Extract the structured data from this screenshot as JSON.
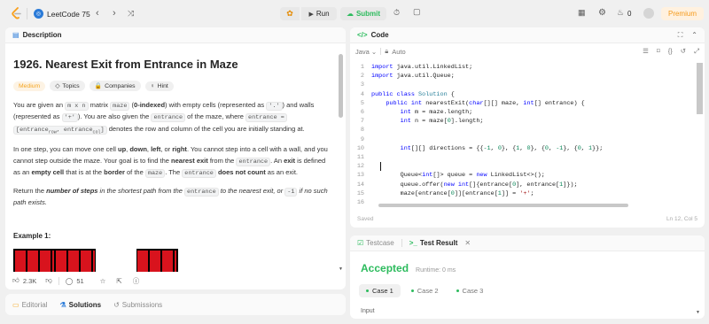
{
  "topbar": {
    "list_title": "LeetCode 75",
    "run": "Run",
    "submit": "Submit",
    "streak": "0",
    "premium": "Premium"
  },
  "left": {
    "tab": "Description",
    "title": "1926. Nearest Exit from Entrance in Maze",
    "difficulty": "Medium",
    "chip_topics": "Topics",
    "chip_companies": "Companies",
    "chip_hint": "Hint",
    "p1": {
      "a": "You are given an ",
      "b": "m x n",
      "c": " matrix ",
      "d": "maze",
      "e": " (",
      "f": "0-indexed",
      "g": ") with empty cells (represented as ",
      "h": "'.'",
      "i": ") and walls (represented as ",
      "j": "'+'",
      "k": "). You are also given the ",
      "l": "entrance",
      "m": " of the maze, where ",
      "n": "entrance =",
      "o": "[entrance",
      "o_sub": "row",
      "p": ", entrance",
      "p_sub": "col",
      "q": "]",
      "r": " denotes the row and column of the cell you are initially standing at."
    },
    "p2": {
      "a": "In one step, you can move one cell ",
      "b": "up",
      "c": ", ",
      "d": "down",
      "e": ", ",
      "f": "left",
      "g": ", or ",
      "h": "right",
      "i": ". You cannot step into a cell with a wall, and you cannot step outside the maze. Your goal is to find the ",
      "j": "nearest exit",
      "k": " from the ",
      "l": "entrance",
      "m": ". An ",
      "n": "exit",
      "o": " is defined as an ",
      "p": "empty cell",
      "q": " that is at the ",
      "r": "border",
      "s": " of the ",
      "t": "maze",
      "u": ". The ",
      "v": "entrance",
      "w": " ",
      "x": "does not count",
      "y": " as an exit."
    },
    "p3": {
      "a": "Return the ",
      "b": "number of steps",
      "c": " in the shortest path from the ",
      "d": "entrance",
      "e": " to the nearest exit, or ",
      "f": "-1",
      "g": " if no such path exists."
    },
    "example": "Example 1:",
    "likes": "2.3K",
    "comments": "51",
    "bottom_tabs": {
      "editorial": "Editorial",
      "solutions": "Solutions",
      "submissions": "Submissions"
    }
  },
  "code": {
    "tab": "Code",
    "language": "Java",
    "auto": "Auto",
    "saved": "Saved",
    "cursor": "Ln 12, Col 5",
    "lines": [
      {
        "n": "1",
        "t": [
          [
            "kw",
            "import"
          ],
          [
            "pl",
            " java.util.LinkedList;"
          ]
        ]
      },
      {
        "n": "2",
        "t": [
          [
            "kw",
            "import"
          ],
          [
            "pl",
            " java.util.Queue;"
          ]
        ]
      },
      {
        "n": "3",
        "t": []
      },
      {
        "n": "4",
        "t": [
          [
            "kw",
            "public class"
          ],
          [
            "ty",
            " Solution"
          ],
          [
            "pl",
            " {"
          ]
        ]
      },
      {
        "n": "5",
        "t": [
          [
            "pl",
            "    "
          ],
          [
            "kw",
            "public int"
          ],
          [
            "pl",
            " nearestExit("
          ],
          [
            "kw",
            "char"
          ],
          [
            "pl",
            "[][] maze, "
          ],
          [
            "kw",
            "int"
          ],
          [
            "pl",
            "[] entrance) {"
          ]
        ]
      },
      {
        "n": "6",
        "t": [
          [
            "pl",
            "        "
          ],
          [
            "kw",
            "int"
          ],
          [
            "pl",
            " m = maze.length;"
          ]
        ]
      },
      {
        "n": "7",
        "t": [
          [
            "pl",
            "        "
          ],
          [
            "kw",
            "int"
          ],
          [
            "pl",
            " n = maze["
          ],
          [
            "nu",
            "0"
          ],
          [
            "pl",
            "].length;"
          ]
        ]
      },
      {
        "n": "8",
        "t": []
      },
      {
        "n": "9",
        "t": []
      },
      {
        "n": "10",
        "t": [
          [
            "pl",
            "        "
          ],
          [
            "kw",
            "int"
          ],
          [
            "pl",
            "[][] directions = {{"
          ],
          [
            "nu",
            "-1"
          ],
          [
            "pl",
            ", "
          ],
          [
            "nu",
            "0"
          ],
          [
            "pl",
            "}, {"
          ],
          [
            "nu",
            "1"
          ],
          [
            "pl",
            ", "
          ],
          [
            "nu",
            "0"
          ],
          [
            "pl",
            "}, {"
          ],
          [
            "nu",
            "0"
          ],
          [
            "pl",
            ", "
          ],
          [
            "nu",
            "-1"
          ],
          [
            "pl",
            "}, {"
          ],
          [
            "nu",
            "0"
          ],
          [
            "pl",
            ", "
          ],
          [
            "nu",
            "1"
          ],
          [
            "pl",
            "}};"
          ]
        ]
      },
      {
        "n": "11",
        "t": []
      },
      {
        "n": "12",
        "t": []
      },
      {
        "n": "13",
        "t": [
          [
            "pl",
            "        Queue<"
          ],
          [
            "kw",
            "int"
          ],
          [
            "pl",
            "[]> queue = "
          ],
          [
            "kw",
            "new"
          ],
          [
            "pl",
            " LinkedList<>();"
          ]
        ]
      },
      {
        "n": "14",
        "t": [
          [
            "pl",
            "        queue.offer("
          ],
          [
            "kw",
            "new int"
          ],
          [
            "pl",
            "[]{entrance["
          ],
          [
            "nu",
            "0"
          ],
          [
            "pl",
            "], entrance["
          ],
          [
            "nu",
            "1"
          ],
          [
            "pl",
            "]});"
          ]
        ]
      },
      {
        "n": "15",
        "t": [
          [
            "pl",
            "        maze[entrance["
          ],
          [
            "nu",
            "0"
          ],
          [
            "pl",
            "]][entrance["
          ],
          [
            "nu",
            "1"
          ],
          [
            "pl",
            "]] = "
          ],
          [
            "st",
            "'+'"
          ],
          [
            "pl",
            ";"
          ]
        ]
      },
      {
        "n": "16",
        "t": []
      }
    ]
  },
  "tests": {
    "tab_testcase": "Testcase",
    "tab_result": "Test Result",
    "status": "Accepted",
    "runtime": "Runtime: 0 ms",
    "cases": [
      "Case 1",
      "Case 2",
      "Case 3"
    ],
    "input_label": "Input"
  }
}
